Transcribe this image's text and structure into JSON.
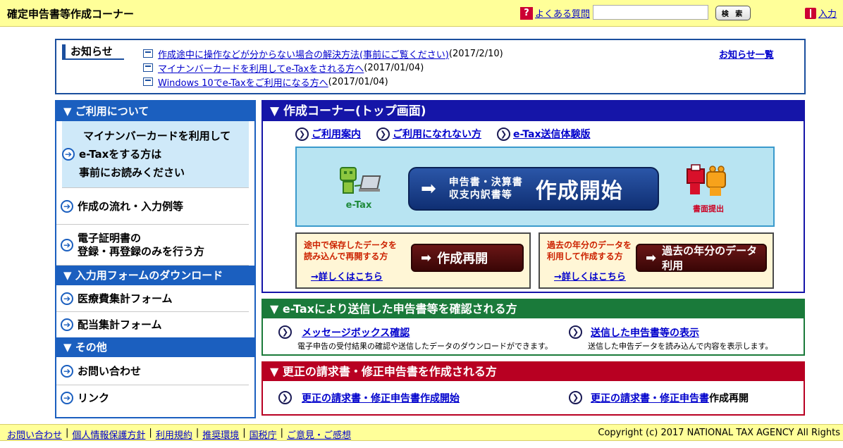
{
  "header": {
    "title": "確定申告書等作成コーナー",
    "faq_icon": "?",
    "faq_label": "よくある質問",
    "search_placeholder": "",
    "search_button": "検 索",
    "entry_label": "入力"
  },
  "notice": {
    "label": "お知らせ",
    "items": [
      {
        "link": "作成途中に操作などが分からない場合の解決方法(事前にご覧ください)",
        "date": "(2017/2/10)"
      },
      {
        "link": "マイナンバーカードを利用してe-Taxをされる方へ",
        "date": "(2017/01/04)"
      },
      {
        "link": "Windows 10でe-Taxをご利用になる方へ",
        "date": "(2017/01/04)"
      }
    ],
    "all_link": "お知らせ一覧"
  },
  "sidebar": {
    "section1": "▼ ご利用について",
    "items1": [
      {
        "lines": [
          "マイナンバーカードを利用して",
          "e-Taxをする方は",
          "事前にお読みください"
        ]
      },
      {
        "lines": [
          "作成の流れ・入力例等"
        ]
      },
      {
        "lines": [
          "電子証明書の",
          "登録・再登録のみを行う方"
        ]
      }
    ],
    "section2": "▼ 入力用フォームのダウンロード",
    "items2": [
      "医療費集計フォーム",
      "配当集計フォーム"
    ],
    "section3": "▼ その他",
    "items3": [
      "お問い合わせ",
      "リンク"
    ]
  },
  "top_panel": {
    "title": "▼ 作成コーナー(トップ画面)",
    "links": [
      "ご利用案内",
      "ご利用になれない方",
      "e-Tax送信体験版"
    ],
    "etax_label": "e-Tax",
    "start_sub1": "申告書・決算書",
    "start_sub2": "収支内訳書等",
    "start_main": "作成開始",
    "submit_label": "書面提出",
    "resume_desc1": "途中で保存したデータを",
    "resume_desc2": "読み込んで再開する方",
    "resume_button": "作成再開",
    "resume_more": "→詳しくはこちら",
    "past_desc1": "過去の年分のデータを",
    "past_desc2": "利用して作成する方",
    "past_button": "過去の年分のデータ利用",
    "past_more": "→詳しくはこちら"
  },
  "etax_panel": {
    "title": "▼ e-Taxにより送信した申告書等を確認される方",
    "link1": "メッセージボックス確認",
    "desc1": "電子申告の受付結果の確認や送信したデータのダウンロードができます。",
    "link2": "送信した申告書等の表示",
    "desc2": "送信した申告データを読み込んで内容を表示します。"
  },
  "correction_panel": {
    "title": "▼ 更正の請求書・修正申告書を作成される方",
    "link1": "更正の請求書・修正申告書作成開始",
    "link2": "更正の請求書・修正申告書",
    "link2_suffix": "作成再開"
  },
  "footer": {
    "links": [
      "お問い合わせ",
      "個人情報保護方針",
      "利用規約",
      "推奨環境",
      "国税庁",
      "ご意見・ご感想"
    ],
    "sep": "|",
    "copyright": "Copyright (c) 2017 NATIONAL TAX AGENCY All Rights"
  }
}
